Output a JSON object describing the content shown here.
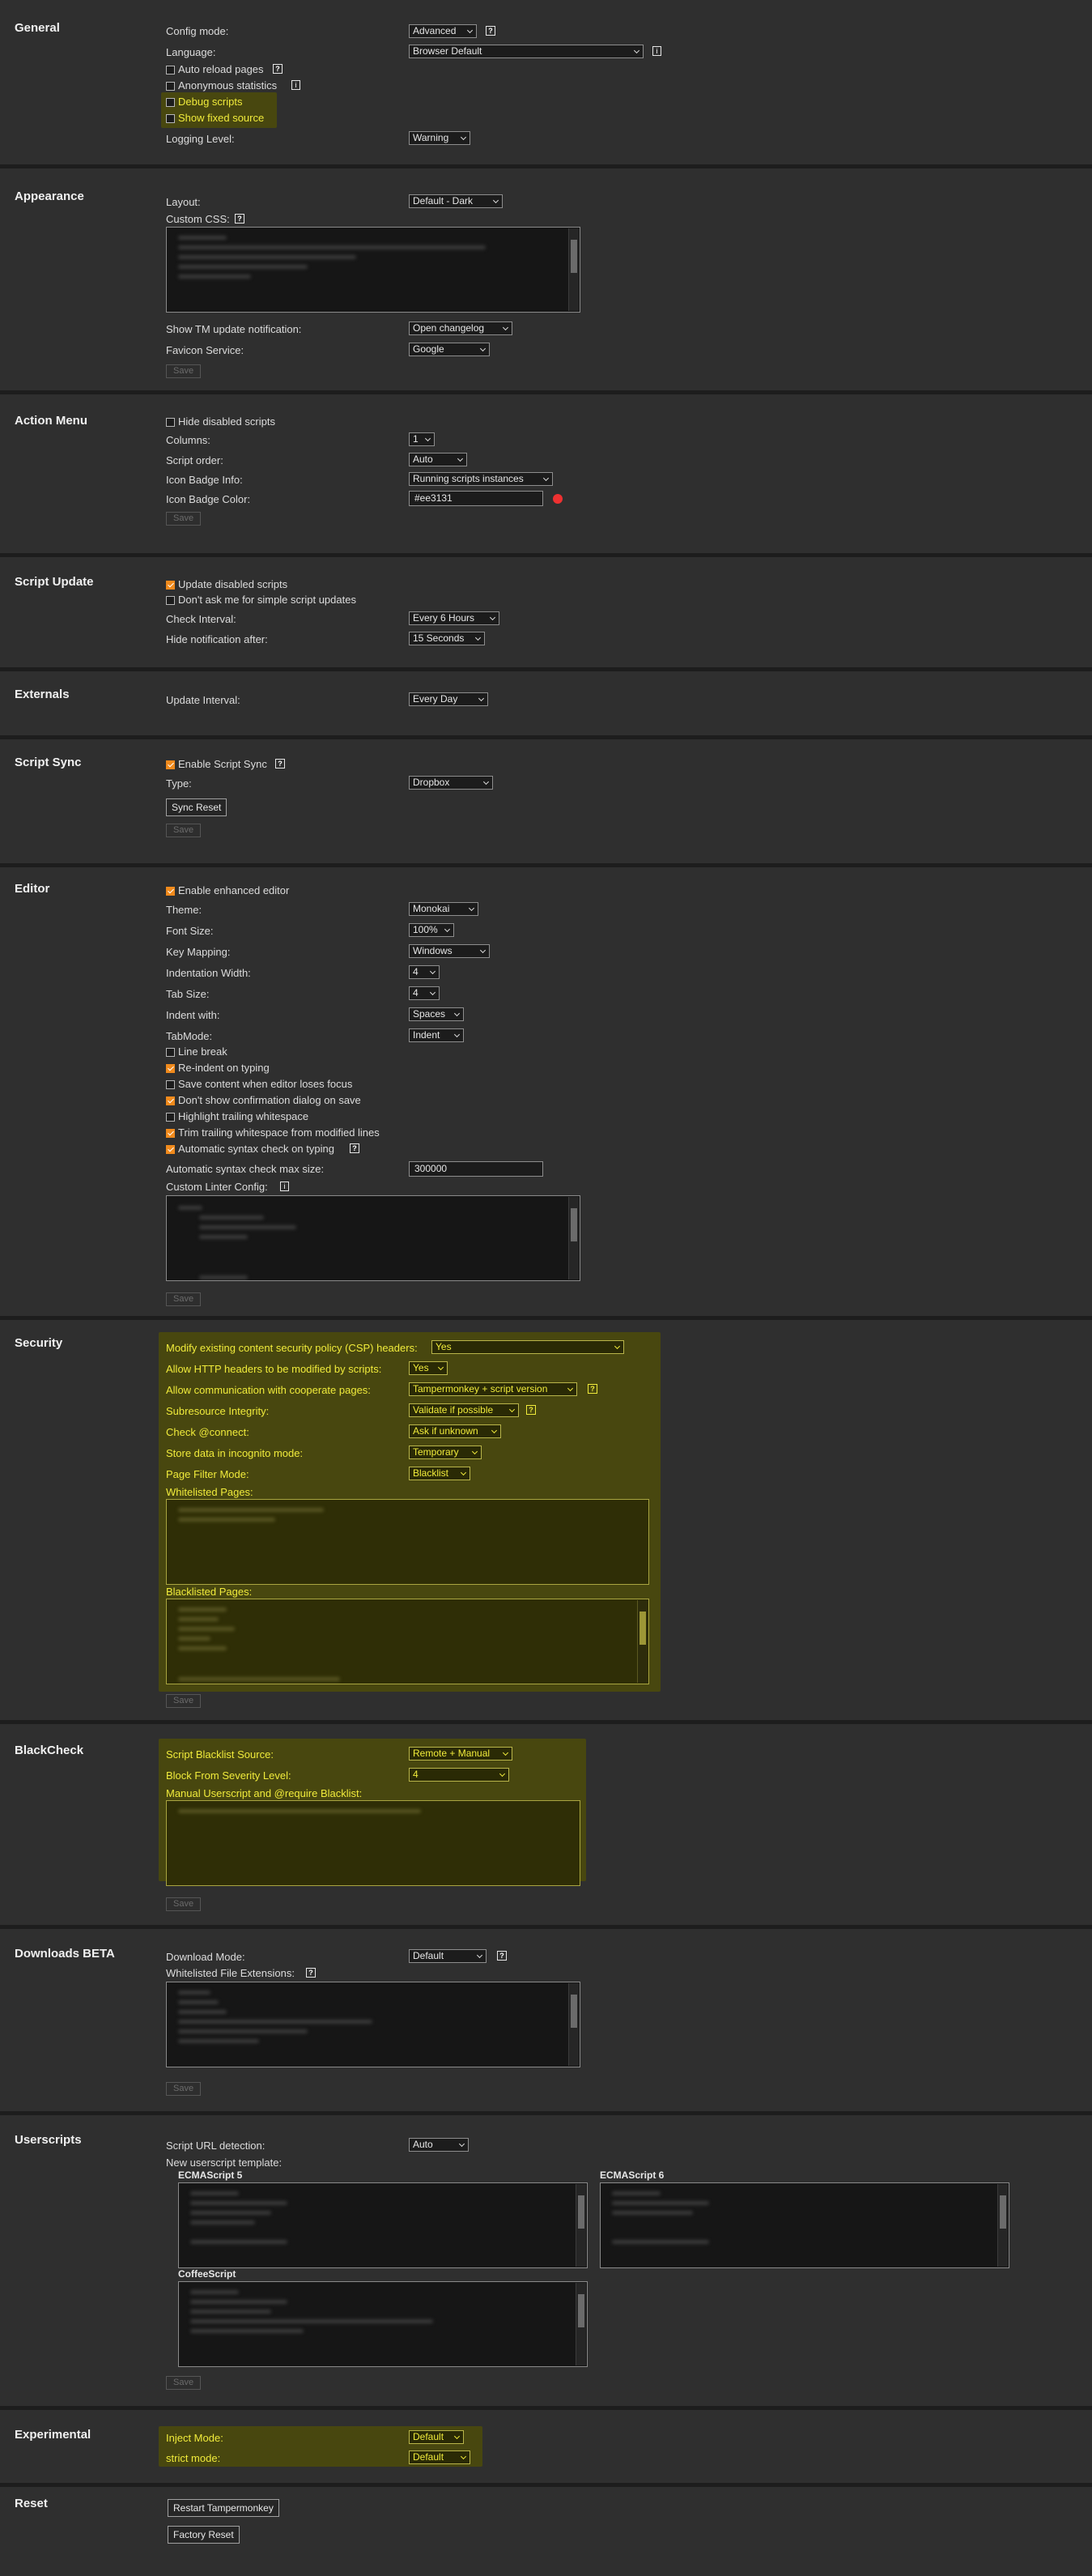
{
  "general": {
    "title": "General",
    "config_mode_label": "Config mode:",
    "config_mode_value": "Advanced",
    "language_label": "Language:",
    "language_value": "Browser Default",
    "auto_reload_label": "Auto reload pages",
    "anon_stats_label": "Anonymous statistics",
    "debug_scripts_label": "Debug scripts",
    "show_fixed_source_label": "Show fixed source",
    "logging_level_label": "Logging Level:",
    "logging_level_value": "Warning"
  },
  "appearance": {
    "title": "Appearance",
    "layout_label": "Layout:",
    "layout_value": "Default - Dark",
    "custom_css_label": "Custom CSS:",
    "show_update_label": "Show TM update notification:",
    "show_update_value": "Open changelog",
    "favicon_label": "Favicon Service:",
    "favicon_value": "Google",
    "save_label": "Save"
  },
  "action_menu": {
    "title": "Action Menu",
    "hide_disabled_label": "Hide disabled scripts",
    "columns_label": "Columns:",
    "columns_value": "1",
    "script_order_label": "Script order:",
    "script_order_value": "Auto",
    "badge_info_label": "Icon Badge Info:",
    "badge_info_value": "Running scripts instances",
    "badge_color_label": "Icon Badge Color:",
    "badge_color_value": "#ee3131",
    "badge_color_hex": "#ee3131",
    "save_label": "Save"
  },
  "script_update": {
    "title": "Script Update",
    "update_disabled_label": "Update disabled scripts",
    "dont_ask_label": "Don't ask me for simple script updates",
    "check_interval_label": "Check Interval:",
    "check_interval_value": "Every 6 Hours",
    "hide_notification_label": "Hide notification after:",
    "hide_notification_value": "15 Seconds"
  },
  "externals": {
    "title": "Externals",
    "update_interval_label": "Update Interval:",
    "update_interval_value": "Every Day"
  },
  "script_sync": {
    "title": "Script Sync",
    "enable_label": "Enable Script Sync",
    "type_label": "Type:",
    "type_value": "Dropbox",
    "sync_reset_label": "Sync Reset",
    "save_label": "Save"
  },
  "editor": {
    "title": "Editor",
    "enhanced_label": "Enable enhanced editor",
    "theme_label": "Theme:",
    "theme_value": "Monokai",
    "font_size_label": "Font Size:",
    "font_size_value": "100%",
    "key_mapping_label": "Key Mapping:",
    "key_mapping_value": "Windows",
    "indent_width_label": "Indentation Width:",
    "indent_width_value": "4",
    "tab_size_label": "Tab Size:",
    "tab_size_value": "4",
    "indent_with_label": "Indent with:",
    "indent_with_value": "Spaces",
    "tabmode_label": "TabMode:",
    "tabmode_value": "Indent",
    "line_break_label": "Line break",
    "reindent_label": "Re-indent on typing",
    "save_on_blur_label": "Save content when editor loses focus",
    "no_confirm_label": "Don't show confirmation dialog on save",
    "highlight_ws_label": "Highlight trailing whitespace",
    "trim_ws_label": "Trim trailing whitespace from modified lines",
    "auto_syntax_label": "Automatic syntax check on typing",
    "syntax_max_label": "Automatic syntax check max size:",
    "syntax_max_value": "300000",
    "linter_config_label": "Custom Linter Config:",
    "save_label": "Save"
  },
  "security": {
    "title": "Security",
    "csp_label": "Modify existing content security policy (CSP) headers:",
    "csp_value": "Yes",
    "http_headers_label": "Allow HTTP headers to be modified by scripts:",
    "http_headers_value": "Yes",
    "cooperate_label": "Allow communication with cooperate pages:",
    "cooperate_value": "Tampermonkey + script version",
    "sri_label": "Subresource Integrity:",
    "sri_value": "Validate if possible",
    "connect_label": "Check @connect:",
    "connect_value": "Ask if unknown",
    "incognito_label": "Store data in incognito mode:",
    "incognito_value": "Temporary",
    "filter_mode_label": "Page Filter Mode:",
    "filter_mode_value": "Blacklist",
    "whitelisted_label": "Whitelisted Pages:",
    "blacklisted_label": "Blacklisted Pages:",
    "save_label": "Save"
  },
  "blackcheck": {
    "title": "BlackCheck",
    "source_label": "Script Blacklist Source:",
    "source_value": "Remote + Manual",
    "severity_label": "Block From Severity Level:",
    "severity_value": "4",
    "manual_label": "Manual Userscript and @require Blacklist:",
    "save_label": "Save"
  },
  "downloads": {
    "title": "Downloads BETA",
    "mode_label": "Download Mode:",
    "mode_value": "Default",
    "extensions_label": "Whitelisted File Extensions:",
    "save_label": "Save"
  },
  "userscripts": {
    "title": "Userscripts",
    "url_detection_label": "Script URL detection:",
    "url_detection_value": "Auto",
    "template_label": "New userscript template:",
    "es5_label": "ECMAScript 5",
    "es6_label": "ECMAScript 6",
    "coffee_label": "CoffeeScript",
    "save_label": "Save"
  },
  "experimental": {
    "title": "Experimental",
    "inject_label": "Inject Mode:",
    "inject_value": "Default",
    "strict_label": "strict mode:",
    "strict_value": "Default"
  },
  "reset": {
    "title": "Reset",
    "restart_label": "Restart Tampermonkey",
    "factory_label": "Factory Reset"
  },
  "icons": {
    "help": "?",
    "info": "i",
    "help_icon": "question-mark-icon",
    "info_icon": "info-icon"
  },
  "colors": {
    "background": "#2f2f2f",
    "highlight": "#48470f",
    "highlight_text": "#f0eb3b",
    "accent": "#f08a1c"
  }
}
